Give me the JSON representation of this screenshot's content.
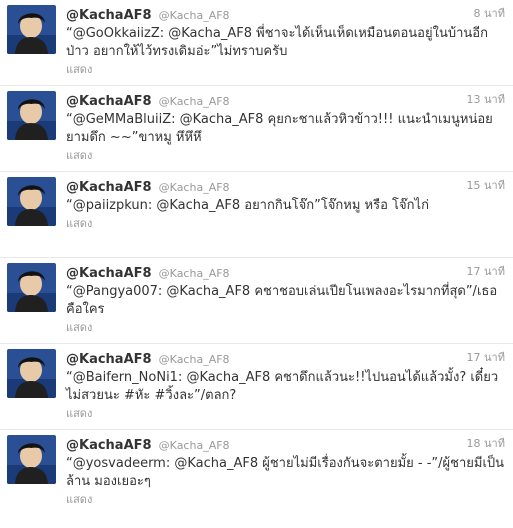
{
  "tweets": [
    {
      "fullname": "@KachaAF8",
      "screenname": "@Kacha_AF8",
      "time": "8 นาที",
      "text": "“@GoOkkaiizZ: @Kacha_AF8 พี่ชาจะได้เห็นเห็ดเหมือนตอนอยู่ในบ้านอีกป่าว อยากให้ไว้ทรงเดิมอ่ะ”ไม่ทราบครับ",
      "action": "แสดง"
    },
    {
      "fullname": "@KachaAF8",
      "screenname": "@Kacha_AF8",
      "time": "13 นาที",
      "text": "“@GeMMaBluiiZ: @Kacha_AF8 คุยกะชาแล้วหิวข้าว!!! แนะนำเมนูหน่อยยามดึก ~~”ขาหมู หึหึหึ",
      "action": "แสดง"
    },
    {
      "fullname": "@KachaAF8",
      "screenname": "@Kacha_AF8",
      "time": "15 นาที",
      "text": "“@paiizpkun: @Kacha_AF8 อยากกินโจ๊ก”โจ๊กหมู หรือ โจ๊กไก่",
      "action": "แสดง"
    },
    {
      "fullname": "@KachaAF8",
      "screenname": "@Kacha_AF8",
      "time": "17 นาที",
      "text": "“@Pangya007: @Kacha_AF8 คชาชอบเล่นเปียโนเพลงอะไรมากที่สุด”/เธอคือใคร",
      "action": "แสดง"
    },
    {
      "fullname": "@KachaAF8",
      "screenname": "@Kacha_AF8",
      "time": "17 นาที",
      "text": "“@Baifern_NoNi1: @Kacha_AF8 คชาดึกแล้วนะ!!ไปนอนได้แล้วมั้ง? เดี๋ยวไม่สวยนะ #หัะ #วิ้งละ”/ตลก?",
      "action": "แสดง"
    },
    {
      "fullname": "@KachaAF8",
      "screenname": "@Kacha_AF8",
      "time": "18 นาที",
      "text": "“@yosvadeerm: @Kacha_AF8 ผู้ชายไม่มีเรื่องกันจะตายมั้ย - -”/ผู้ชายมีเป็นล้าน มองเยอะๆ",
      "action": "แสดง"
    }
  ]
}
